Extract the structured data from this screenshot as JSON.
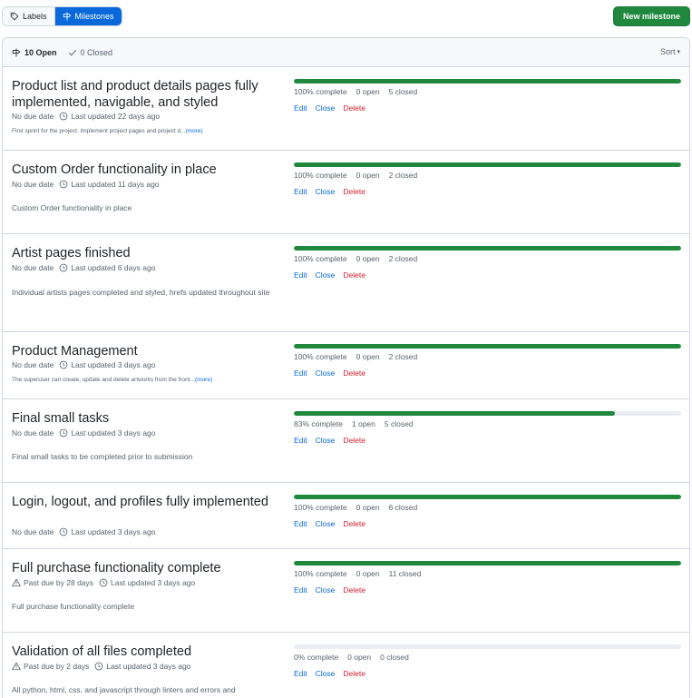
{
  "nav": {
    "labels": "Labels",
    "milestones": "Milestones",
    "new_milestone": "New milestone"
  },
  "header": {
    "open": "10 Open",
    "closed": "0 Closed",
    "sort": "Sort"
  },
  "actions": {
    "edit": "Edit",
    "close": "Close",
    "delete": "Delete"
  },
  "more_label": "(more)",
  "milestones": [
    {
      "title": "Product list and product details pages fully implemented, navigable, and styled",
      "due": "No due date",
      "due_warning": false,
      "updated": "Last updated 22 days ago",
      "description": "First sprint for the project. Implement project pages and project d...",
      "truncated": true,
      "progress": 1.0,
      "complete": "100% complete",
      "open": "0 open",
      "closed": "5 closed"
    },
    {
      "title": "Custom Order functionality in place",
      "due": "No due date",
      "due_warning": false,
      "updated": "Last updated 11 days ago",
      "description": "Custom Order functionality in place",
      "truncated": false,
      "progress": 1.0,
      "complete": "100% complete",
      "open": "0 open",
      "closed": "2 closed"
    },
    {
      "title": "Artist pages finished",
      "due": "No due date",
      "due_warning": false,
      "updated": "Last updated 6 days ago",
      "description": "Individual artists pages completed and styled, hrefs updated throughout site",
      "truncated": false,
      "progress": 1.0,
      "complete": "100% complete",
      "open": "0 open",
      "closed": "2 closed"
    },
    {
      "title": "Product Management",
      "due": "No due date",
      "due_warning": false,
      "updated": "Last updated 3 days ago",
      "description": "The superuser can create, update and delete artworks from the front...",
      "truncated": true,
      "progress": 1.0,
      "complete": "100% complete",
      "open": "0 open",
      "closed": "2 closed"
    },
    {
      "title": "Final small tasks",
      "due": "No due date",
      "due_warning": false,
      "updated": "Last updated 3 days ago",
      "description": "Final small tasks to be completed prior to submission",
      "truncated": false,
      "progress": 0.83,
      "complete": "83% complete",
      "open": "1 open",
      "closed": "5 closed"
    },
    {
      "title": "Login, logout, and profiles fully implemented",
      "due": "No due date",
      "due_warning": false,
      "updated": "Last updated 3 days ago",
      "description": "",
      "truncated": false,
      "progress": 1.0,
      "complete": "100% complete",
      "open": "0 open",
      "closed": "6 closed"
    },
    {
      "title": "Full purchase functionality complete",
      "due": "Past due by 28 days",
      "due_warning": true,
      "updated": "Last updated 3 days ago",
      "description": "Full purchase functionality complete",
      "truncated": false,
      "progress": 1.0,
      "complete": "100% complete",
      "open": "0 open",
      "closed": "11 closed"
    },
    {
      "title": "Validation of all files completed",
      "due": "Past due by 2 days",
      "due_warning": true,
      "updated": "Last updated 3 days ago",
      "description": "All python, html, css, and javascript through linters and errors and",
      "truncated": false,
      "progress": 0.0,
      "complete": "0% complete",
      "open": "0 open",
      "closed": "0 closed"
    }
  ]
}
